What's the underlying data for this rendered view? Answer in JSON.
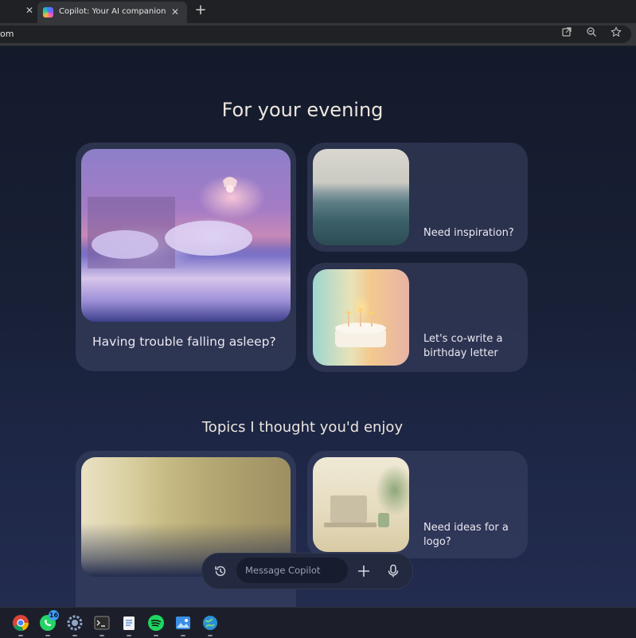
{
  "browser": {
    "tab_title": "Copilot: Your AI companion",
    "url_fragment": "om",
    "tab_close_glyph": "✕",
    "new_tab_glyph": "+",
    "omnibox_icons": [
      "open-in-app-icon",
      "zoom-icon",
      "bookmark-star-icon"
    ]
  },
  "page": {
    "section1_title": "For your evening",
    "section1_cards": [
      {
        "label": "Having trouble falling asleep?",
        "image": "bedroom-illustration"
      },
      {
        "label": "Need inspiration?",
        "image": "sea-illustration"
      },
      {
        "label": "Let's co-write a birthday letter",
        "image": "birthday-cake-illustration"
      }
    ],
    "section2_title": "Topics I thought you'd enjoy",
    "section2_cards": [
      {
        "label": "",
        "image": "forest-light-illustration"
      },
      {
        "label": "Need ideas for a logo?",
        "image": "desk-laptop-illustration"
      }
    ]
  },
  "composer": {
    "placeholder": "Message Copilot",
    "icons": [
      "history-icon",
      "plus-icon",
      "microphone-icon"
    ]
  },
  "taskbar": {
    "apps": [
      "chrome-icon",
      "whatsapp-icon",
      "settings-icon",
      "terminal-icon",
      "notepad-icon",
      "spotify-icon",
      "photos-icon",
      "browser-globe-icon"
    ],
    "whatsapp_badge": "16"
  },
  "colors": {
    "page_bg_top": "#141a2a",
    "page_bg_bottom": "#232c4f",
    "card_bg": "#3c4464",
    "heading_text": "#ece6df",
    "badge": "#3ea0f5"
  }
}
